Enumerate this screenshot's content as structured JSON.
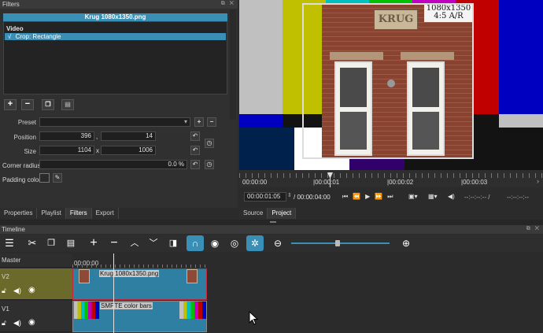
{
  "filters_dock": {
    "title": "Filters",
    "header_title": "Krug 1080x1350.png",
    "category": "Video",
    "selected_filter": "Crop: Rectangle",
    "check_mark": "√",
    "preset_label": "Preset",
    "position_label": "Position",
    "position_x": "396",
    "position_sep": ",",
    "position_y": "14",
    "size_label": "Size",
    "size_w": "1104",
    "size_sep": "x",
    "size_h": "1006",
    "corner_label": "Corner radius",
    "corner_value": "0.0 %",
    "padding_label": "Padding color"
  },
  "bottom_tabs_left": [
    "Properties",
    "Playlist",
    "Filters",
    "Export"
  ],
  "bottom_tabs_right": [
    "Source",
    "Project"
  ],
  "player": {
    "overlay_line1": "1080x1350",
    "overlay_line2": "4:5 A/R",
    "sign_text": "KRUG",
    "ruler": [
      "00:00:00",
      "|00:00:01",
      "|00:00:02",
      "|00:00:03"
    ],
    "current_time": "00:00:01:05",
    "total_time": "/ 00:00:04:00",
    "in_point": "--:--:--:-- /",
    "out_point": "--:--:--:--"
  },
  "timeline": {
    "title": "Timeline",
    "master_label": "Master",
    "ruler_start": "00:00:00",
    "tracks": [
      {
        "name": "V2",
        "clip": "Krug 1080x1350.png"
      },
      {
        "name": "V1",
        "clip": "SMPTE color bars"
      }
    ]
  },
  "colors": {
    "accent": "#3a8fb7",
    "v2_header": "#6b6a2a",
    "clip": "#2e7fa2",
    "selected_clip_border": "#c8283a"
  }
}
